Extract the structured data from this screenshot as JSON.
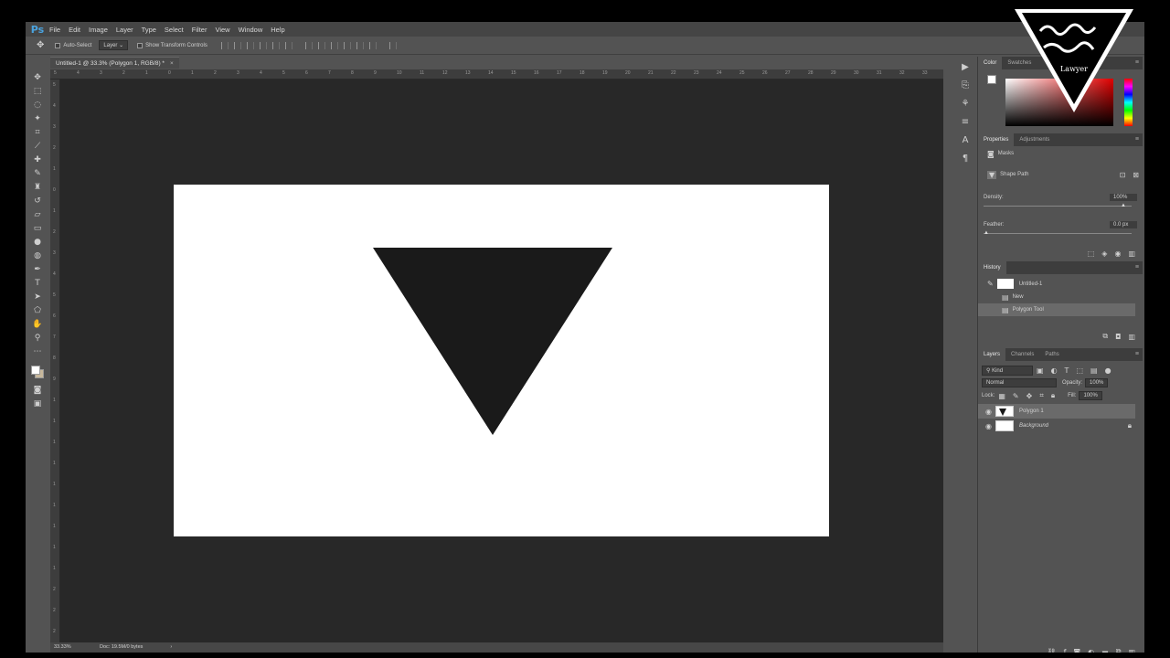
{
  "app": {
    "logo": "Ps"
  },
  "menu": [
    "File",
    "Edit",
    "Image",
    "Layer",
    "Type",
    "Select",
    "Filter",
    "View",
    "Window",
    "Help"
  ],
  "options": {
    "auto_select": "Auto-Select",
    "auto_select_target": "Layer",
    "show_transform": "Show Transform Controls"
  },
  "document": {
    "tab_title": "Untitled-1 @ 33.3% (Polygon 1, RGB/8) *",
    "ruler_h": [
      "5",
      "4",
      "3",
      "2",
      "1",
      "0",
      "1",
      "2",
      "3",
      "4",
      "5",
      "6",
      "7",
      "8",
      "9",
      "10",
      "11",
      "12",
      "13",
      "14",
      "15",
      "16",
      "17",
      "18",
      "19",
      "20",
      "21",
      "22",
      "23",
      "24",
      "25",
      "26",
      "27",
      "28",
      "29",
      "30",
      "31",
      "32",
      "33"
    ],
    "ruler_v": [
      "5",
      "4",
      "3",
      "2",
      "1",
      "0",
      "1",
      "2",
      "3",
      "4",
      "5",
      "6",
      "7",
      "8",
      "9",
      "1",
      "1",
      "1",
      "1",
      "1",
      "1",
      "1",
      "1",
      "1",
      "2",
      "2",
      "2"
    ],
    "shape_color": "#1a1a1a",
    "canvas_color": "#ffffff",
    "zoom": "33.33%",
    "doc_info": "Doc: 19.5M/0 bytes"
  },
  "color_panel": {
    "tab_color": "Color",
    "tab_swatches": "Swatches",
    "fg": "#ffffff",
    "bg": "#c8b89c"
  },
  "properties": {
    "tab_properties": "Properties",
    "tab_adjustments": "Adjustments",
    "masks": "Masks",
    "shape_path": "Shape Path",
    "density_label": "Density:",
    "density_value": "100%",
    "density_level": 1.0,
    "feather_label": "Feather:",
    "feather_value": "0.0 px",
    "feather_level": 0.0
  },
  "history": {
    "title": "History",
    "snapshot": "Untitled-1",
    "items": [
      "New",
      "Polygon Tool"
    ]
  },
  "layers": {
    "tab_layers": "Layers",
    "tab_channels": "Channels",
    "tab_paths": "Paths",
    "kind": "Kind",
    "blend": "Normal",
    "opacity_label": "Opacity:",
    "opacity_value": "100%",
    "lock_label": "Lock:",
    "fill_label": "Fill:",
    "fill_value": "100%",
    "items": [
      {
        "name": "Polygon 1"
      },
      {
        "name": "Background"
      }
    ]
  },
  "watermark": {
    "text": "Lawyer"
  }
}
